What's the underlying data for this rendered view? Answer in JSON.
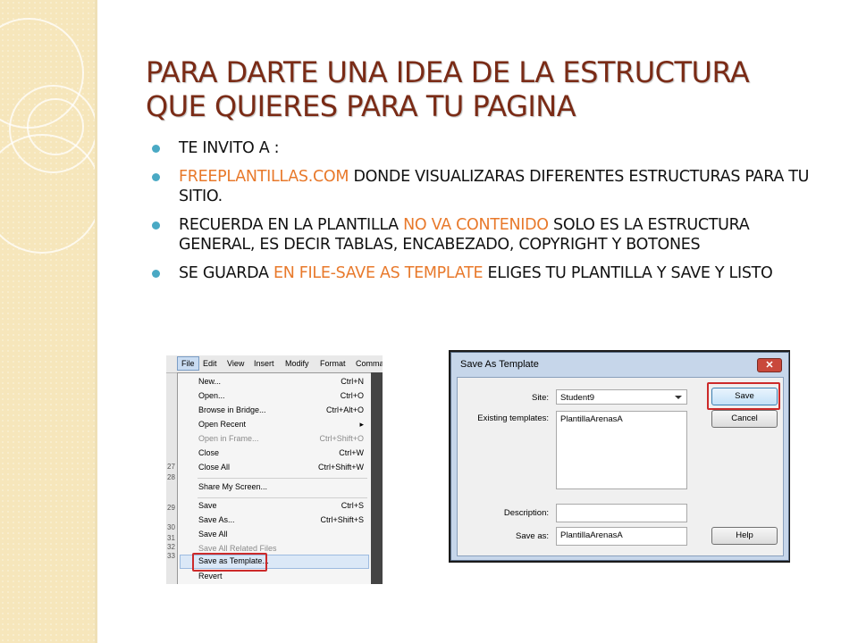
{
  "slide": {
    "title_line1": "PARA DARTE UNA IDEA DE LA ESTRUCTURA",
    "title_line2": "QUE QUIERES PARA TU PAGINA",
    "bullets": [
      {
        "text": "TE INVITO A :"
      },
      {
        "highlight": "FREEPLANTILLAS.COM",
        "text": " DONDE VISUALIZARAS DIFERENTES ESTRUCTURAS PARA TU SITIO."
      },
      {
        "before": "RECUERDA EN LA PLANTILLA ",
        "highlight": "NO VA CONTENIDO",
        "after": " SOLO ES LA ESTRUCTURA GENERAL, ES DECIR TABLAS, ENCABEZADO, COPYRIGHT Y BOTONES"
      },
      {
        "before": "SE GUARDA ",
        "highlight": "EN FILE-SAVE AS TEMPLATE",
        "after": " ELIGES TU PLANTILLA Y SAVE Y LISTO"
      }
    ]
  },
  "file_menu": {
    "menubar": [
      "File",
      "Edit",
      "View",
      "Insert",
      "Modify",
      "Format",
      "Comma"
    ],
    "items": [
      {
        "label": "New...",
        "shortcut": "Ctrl+N"
      },
      {
        "label": "Open...",
        "shortcut": "Ctrl+O"
      },
      {
        "label": "Browse in Bridge...",
        "shortcut": "Ctrl+Alt+O"
      },
      {
        "label": "Open Recent",
        "shortcut": "▸"
      },
      {
        "label": "Open in Frame...",
        "shortcut": "Ctrl+Shift+O"
      },
      {
        "label": "Close",
        "shortcut": "Ctrl+W"
      },
      {
        "label": "Close All",
        "shortcut": "Ctrl+Shift+W"
      },
      {
        "label": "Share My Screen...",
        "shortcut": ""
      },
      {
        "label": "Save",
        "shortcut": "Ctrl+S"
      },
      {
        "label": "Save As...",
        "shortcut": "Ctrl+Shift+S"
      },
      {
        "label": "Save All",
        "shortcut": ""
      },
      {
        "label": "Save All Related Files",
        "shortcut": ""
      },
      {
        "label": "Save as Template...",
        "shortcut": ""
      },
      {
        "label": "Revert",
        "shortcut": ""
      }
    ],
    "gutter_numbers": [
      "27",
      "28",
      "29",
      "30",
      "31",
      "32",
      "33"
    ]
  },
  "dialog": {
    "title": "Save As Template",
    "close_symbol": "✕",
    "site_label": "Site:",
    "site_value": "Student9",
    "existing_label": "Existing templates:",
    "existing_item": "PlantillaArenasA",
    "description_label": "Description:",
    "description_value": "",
    "saveas_label": "Save as:",
    "saveas_value": "PlantillaArenasA",
    "save_button": "Save",
    "cancel_button": "Cancel",
    "help_button": "Help"
  },
  "colors": {
    "title": "#7a2b16",
    "bullet_dot": "#4aa9c4",
    "highlight": "#e8792b",
    "side_panel": "#f6e6bb",
    "callout_box": "#cc2a2a"
  }
}
